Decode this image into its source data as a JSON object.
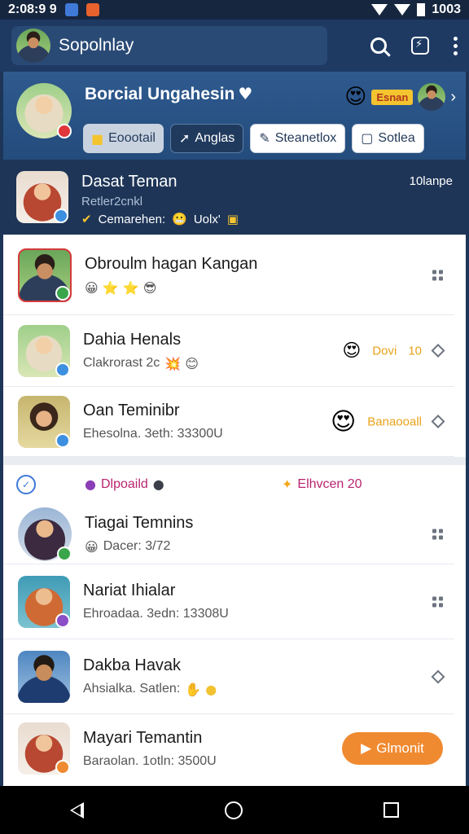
{
  "status_bar": {
    "time": "2:08:9 9",
    "clock_right": "1003"
  },
  "app_bar": {
    "title": "Sopolnlay"
  },
  "hero": {
    "name": "Borcial Ungahesin",
    "tag": "Esnan",
    "buttons": [
      {
        "label": "Eoootail",
        "icon": "star-icon"
      },
      {
        "label": "Anglas",
        "icon": "arrow-icon"
      },
      {
        "label": "Steanetlox",
        "icon": "tag-icon"
      },
      {
        "label": "Sotlea",
        "icon": "chat-icon"
      }
    ]
  },
  "featured": {
    "name": "Dasat Teman",
    "sub": "Retler2cnkl",
    "line_text": "Cemarehen:",
    "line_suffix": "Uolx'",
    "time": "10lanpe"
  },
  "list_a": [
    {
      "name": "Obroulm hagan Kangan",
      "sub": "",
      "trail_type": "grip",
      "avatar": "man"
    },
    {
      "name": "Dahia Henals",
      "sub": "Clakrorast 2c",
      "trail_type": "tag",
      "tag": "Dovi",
      "num": "10",
      "avatar": "hijab"
    },
    {
      "name": "Oan Teminibr",
      "sub": "Ehesolna. 3eth: 33300U",
      "trail_type": "tag2",
      "tag": "Banaooall",
      "avatar": "woman"
    }
  ],
  "group_head": {
    "left_label": "Dlpoaild",
    "right_label": "Elhvcen 20"
  },
  "list_b": [
    {
      "name": "Tiagai Temnins",
      "sub": "Dacer: 3/72",
      "trail_type": "grip",
      "avatar": "hijab-dark"
    },
    {
      "name": "Nariat Ihialar",
      "sub": "Ehroadaa. 3edn: 13308U",
      "trail_type": "grip",
      "avatar": "hijab-orange"
    },
    {
      "name": "Dakba Havak",
      "sub": "Ahsialka. Satlen:",
      "trail_type": "diamond",
      "avatar": "boy"
    },
    {
      "name": "Mayari Temantin",
      "sub": "Baraolan. 1otln: 3500U",
      "trail_type": "button",
      "button": "Glmonit",
      "avatar": "hijab-red"
    }
  ],
  "colors": {
    "app_bar": "#1e3a63",
    "hero": "#2f5a8f",
    "featured": "#1e3557",
    "accent_orange": "#f08a30",
    "magenta_text": "#b8256f"
  }
}
